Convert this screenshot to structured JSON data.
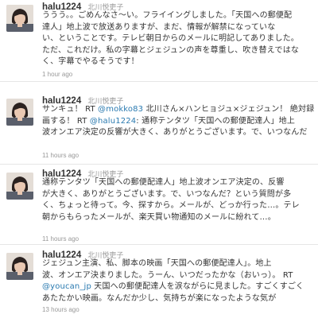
{
  "colors": {
    "link": "#2a7ab0",
    "text": "#333333",
    "muted": "#999999",
    "divider": "#e6e6e6"
  },
  "tweets": [
    {
      "screen_name": "halu1224",
      "full_name": "北川悦吏子",
      "avatar_icon": "profile-photo-avatar",
      "lines": [
        [
          "ううう。。ごめんなさ〜い。フライイングしました。「天国への郵便配"
        ],
        [
          "達人」地上波で放送ありますが、まだ、情報が解禁になっていな"
        ],
        [
          "い、ということです。テレビ朝日からのメールに明記してありました。"
        ],
        [
          "ただ、これだけ。私の字幕とジェジュンの声を尊重し、吹き替えではな"
        ],
        [
          "く、字幕でやるそうです！"
        ]
      ],
      "time": "1 hour ago"
    },
    {
      "screen_name": "halu1224",
      "full_name": "北川悦吏子",
      "avatar_icon": "profile-photo-avatar",
      "lines": [
        [
          "サンキュ！ RT ",
          {
            "mention": "@mokko83"
          },
          " 北川さん×ハンヒョジュ×ジェジュン！ 絶対録"
        ],
        [
          "画する！ RT ",
          {
            "mention": "@halu1224"
          },
          ": 通称テンタツ「天国への郵便配達人」地上"
        ],
        [
          "波オンエア決定の反響が大きく、ありがとうございます。で、いつなんだ"
        ]
      ],
      "time": "11 hours ago"
    },
    {
      "screen_name": "halu1224",
      "full_name": "北川悦吏子",
      "avatar_icon": "profile-photo-avatar",
      "lines": [
        [
          "通称テンタツ「天国への郵便配達人」地上波オンエア決定の、反響"
        ],
        [
          "が大きく、ありがとうございます。で、いつなんだ？という質問が多"
        ],
        [
          "く、ちょっと待って。今、探すから。メールが、どっか行った…。テレ"
        ],
        [
          "朝からもらったメールが、楽天買い物通知のメールに紛れて…。"
        ]
      ],
      "time": "11 hours ago"
    },
    {
      "screen_name": "halu1224",
      "full_name": "北川悦吏子",
      "avatar_icon": "profile-photo-avatar",
      "lines": [
        [
          "ジェジュン主演、私、脚本の映画「天国への郵便配達人」。地上"
        ],
        [
          "波、オンエア決まりました。うーん、いつだったかな（おいっ）。 RT"
        ],
        [
          {
            "mention": "@youcan_jp"
          },
          " 天国への郵便配達人を涙ながらに見ました。すごくすごく"
        ],
        [
          "あたたかい映画。なんだか少し、気持ちが楽になったような気が"
        ]
      ],
      "time": "13 hours ago"
    }
  ]
}
